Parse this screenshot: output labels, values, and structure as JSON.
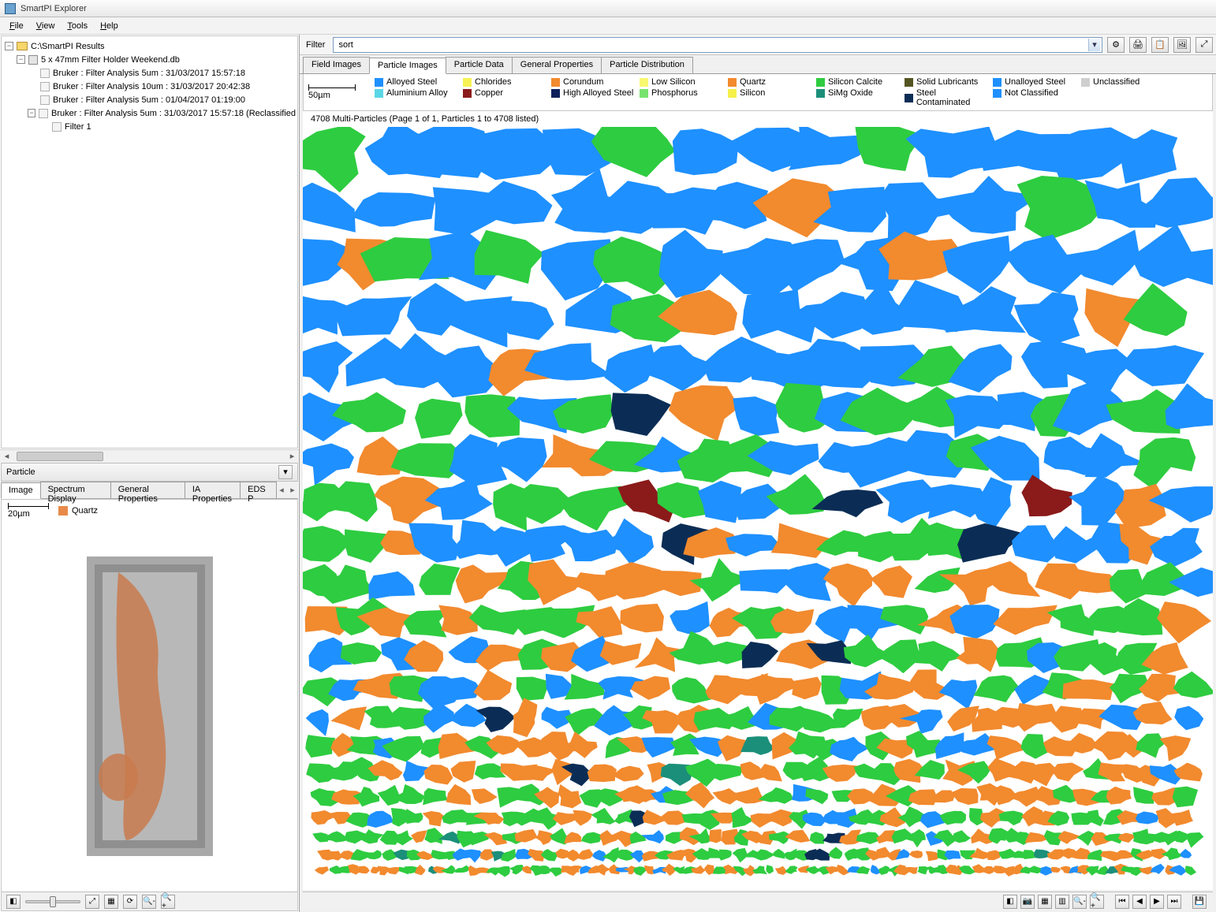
{
  "title": "SmartPI Explorer",
  "menu": [
    "File",
    "View",
    "Tools",
    "Help"
  ],
  "tree": {
    "root": "C:\\SmartPI Results",
    "db": "5 x 47mm Filter Holder Weekend.db",
    "items": [
      "Bruker : Filter Analysis 5um : 31/03/2017 15:57:18",
      "Bruker : Filter Analysis 10um : 31/03/2017 20:42:38",
      "Bruker : Filter Analysis 5um : 01/04/2017 01:19:00",
      "Bruker : Filter Analysis 5um : 31/03/2017 15:57:18 (Reclassified"
    ],
    "leaf": "Filter 1"
  },
  "particlePanel": {
    "title": "Particle",
    "tabs": [
      "Image",
      "Spectrum Display",
      "General Properties",
      "IA Properties",
      "EDS P"
    ],
    "scale": "20µm",
    "legend_label": "Quartz",
    "legend_color": "#e88a4a"
  },
  "filter": {
    "label": "Filter",
    "value": "sort"
  },
  "mainTabs": [
    "Field Images",
    "Particle Images",
    "Particle Data",
    "General Properties",
    "Particle Distribution"
  ],
  "mainScale": "50µm",
  "legend": [
    {
      "label": "Alloyed Steel",
      "color": "#1e90ff"
    },
    {
      "label": "Aluminium Alloy",
      "color": "#5ad6e6"
    },
    {
      "label": "Chlorides",
      "color": "#f8f254"
    },
    {
      "label": "Copper",
      "color": "#8b1a1a"
    },
    {
      "label": "Corundum",
      "color": "#f28a2e"
    },
    {
      "label": "High Alloyed Steel",
      "color": "#0b1e5a"
    },
    {
      "label": "Low Silicon",
      "color": "#f9f871"
    },
    {
      "label": "Phosphorus",
      "color": "#77e36f"
    },
    {
      "label": "Quartz",
      "color": "#f28a2e"
    },
    {
      "label": "Silicon",
      "color": "#f6f04a"
    },
    {
      "label": "Silicon Calcite",
      "color": "#2ecc40"
    },
    {
      "label": "SiMg Oxide",
      "color": "#1b8f7a"
    },
    {
      "label": "Solid Lubricants",
      "color": "#555522"
    },
    {
      "label": "Steel Contaminated",
      "color": "#0b2d55"
    },
    {
      "label": "Unalloyed Steel",
      "color": "#1e90ff"
    },
    {
      "label": "Not Classified",
      "color": "#1e90ff"
    },
    {
      "label": "Unclassified",
      "color": "#cfcfcf"
    }
  ],
  "countLabel": "4708 Multi-Particles (Page 1 of 1, Particles 1 to 4708 listed)",
  "toolbar_icons": [
    "⚙",
    "🖨",
    "📋",
    "🖼",
    "⤢"
  ],
  "bottom_icons_left": [
    "◧",
    "⤢",
    "▦",
    "⟳",
    "🔍-",
    "🔍+"
  ],
  "bottom_icons_right_tools": [
    "◧",
    "📷",
    "▦",
    "▥",
    "🔍-",
    "🔍+"
  ],
  "bottom_nav": [
    "⏮",
    "◀",
    "▶",
    "⏭"
  ],
  "bottom_save": "💾"
}
